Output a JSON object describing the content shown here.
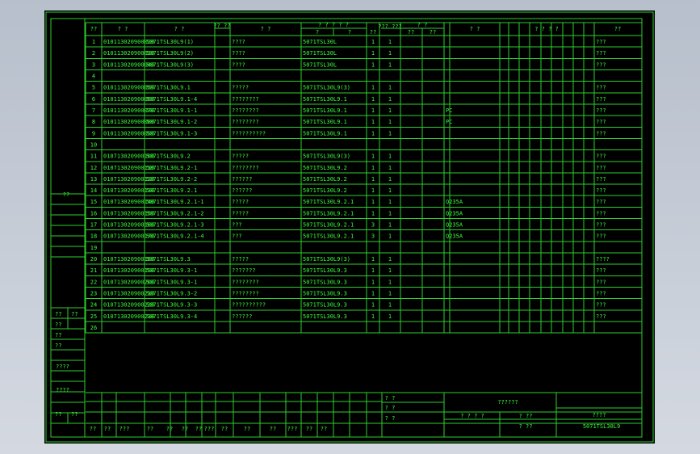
{
  "header": {
    "col_idx": "??",
    "col_code": "? ?",
    "col_drawing_no": "? ?",
    "col_mark": "?? ??",
    "col_name": "? ?",
    "col_ref_group": "? ? ? ? ?",
    "col_ref_sub1": "?",
    "col_ref_sub2": "?",
    "col_ref_sub3": "??",
    "col_qty": "??? ???",
    "col_weight": "? ?",
    "col_weight_sub1": "??",
    "col_weight_sub2": "??",
    "col_material": "? ?",
    "col_remark": "? ? ? ?",
    "col_last": "??"
  },
  "rows": [
    {
      "n": "1",
      "code": "010113020900020",
      "dwg": "5071TSL30L9(1)",
      "name": "????",
      "ref": "5071TSL30L",
      "a": "1",
      "b": "1",
      "mat": "",
      "rem": "???"
    },
    {
      "n": "2",
      "code": "010113020900030",
      "dwg": "5071TSL30L9(2)",
      "name": "????",
      "ref": "5071TSL30L",
      "a": "1",
      "b": "1",
      "mat": "",
      "rem": "???"
    },
    {
      "n": "3",
      "code": "010113020900040",
      "dwg": "5071TSL30L9(3)",
      "name": "????",
      "ref": "5071TSL30L",
      "a": "1",
      "b": "1",
      "mat": "",
      "rem": "???"
    },
    {
      "n": "4",
      "code": "",
      "dwg": "",
      "name": "",
      "ref": "",
      "a": "",
      "b": "",
      "mat": "",
      "rem": ""
    },
    {
      "n": "5",
      "code": "010113020900050",
      "dwg": "5071TSL30L9.1",
      "name": "?????",
      "ref": "5071TSL30L9(3)",
      "a": "1",
      "b": "1",
      "mat": "",
      "rem": "???"
    },
    {
      "n": "6",
      "code": "010113020900060",
      "dwg": "5071TSL30L9.1-4",
      "name": "????????",
      "ref": "5071TSL30L9.1",
      "a": "1",
      "b": "1",
      "mat": "",
      "rem": "???"
    },
    {
      "n": "7",
      "code": "010113020900070",
      "dwg": "5071TSL30L9.1-1",
      "name": "????????",
      "ref": "5071TSL30L9.1",
      "a": "1",
      "b": "1",
      "mat": "PC",
      "rem": "???"
    },
    {
      "n": "8",
      "code": "010113020900080",
      "dwg": "5071TSL30L9.1-2",
      "name": "????????",
      "ref": "5071TSL30L9.1",
      "a": "1",
      "b": "1",
      "mat": "PC",
      "rem": "???"
    },
    {
      "n": "9",
      "code": "010113020900090",
      "dwg": "5071TSL30L9.1-3",
      "name": "??????????",
      "ref": "5071TSL30L9.1",
      "a": "1",
      "b": "1",
      "mat": "",
      "rem": "???"
    },
    {
      "n": "10",
      "code": "",
      "dwg": "",
      "name": "",
      "ref": "",
      "a": "",
      "b": "",
      "mat": "",
      "rem": ""
    },
    {
      "n": "11",
      "code": "010713020900100",
      "dwg": "5071TSL30L9.2",
      "name": "?????",
      "ref": "5071TSL30L9(3)",
      "a": "1",
      "b": "1",
      "mat": "",
      "rem": "???"
    },
    {
      "n": "12",
      "code": "010713020900110",
      "dwg": "5071TSL30L9.2-1",
      "name": "????????",
      "ref": "5071TSL30L9.2",
      "a": "1",
      "b": "1",
      "mat": "",
      "rem": "???"
    },
    {
      "n": "13",
      "code": "010713020900120",
      "dwg": "5071TSL30L9.2-2",
      "name": "??????",
      "ref": "5071TSL30L9.2",
      "a": "1",
      "b": "1",
      "mat": "",
      "rem": "???"
    },
    {
      "n": "14",
      "code": "010713020900130",
      "dwg": "5071TSL30L9.2.1",
      "name": "??????",
      "ref": "5071TSL30L9.2",
      "a": "1",
      "b": "1",
      "mat": "",
      "rem": "???"
    },
    {
      "n": "15",
      "code": "010713020900140",
      "dwg": "5071TSL30L9.2.1-1",
      "name": "?????",
      "ref": "5071TSL30L9.2.1",
      "a": "1",
      "b": "1",
      "mat": "Q235A",
      "rem": "???"
    },
    {
      "n": "16",
      "code": "010713020900150",
      "dwg": "5071TSL30L9.2.1-2",
      "name": "?????",
      "ref": "5071TSL30L9.2.1",
      "a": "1",
      "b": "1",
      "mat": "Q235A",
      "rem": "???"
    },
    {
      "n": "17",
      "code": "010713020900160",
      "dwg": "5071TSL30L9.2.1-3",
      "name": "???",
      "ref": "5071TSL30L9.2.1",
      "a": "3",
      "b": "1",
      "mat": "Q235A",
      "rem": "???"
    },
    {
      "n": "18",
      "code": "010713020900170",
      "dwg": "5071TSL30L9.2.1-4",
      "name": "???",
      "ref": "5071TSL30L9.2.1",
      "a": "3",
      "b": "1",
      "mat": "Q235A",
      "rem": "???"
    },
    {
      "n": "19",
      "code": "",
      "dwg": "",
      "name": "",
      "ref": "",
      "a": "",
      "b": "",
      "mat": "",
      "rem": ""
    },
    {
      "n": "20",
      "code": "010713020900180",
      "dwg": "5071TSL30L9.3",
      "name": "?????",
      "ref": "5071TSL30L9(3)",
      "a": "1",
      "b": "1",
      "mat": "",
      "rem": "????"
    },
    {
      "n": "21",
      "code": "010713020900190",
      "dwg": "5071TSL30L9.3-1",
      "name": "???????",
      "ref": "5071TSL30L9.3",
      "a": "1",
      "b": "1",
      "mat": "",
      "rem": "???"
    },
    {
      "n": "22",
      "code": "010713020900200",
      "dwg": "5071TSL30L9.3-1",
      "name": "????????",
      "ref": "5071TSL30L9.3",
      "a": "1",
      "b": "1",
      "mat": "",
      "rem": "???"
    },
    {
      "n": "23",
      "code": "010713020900210",
      "dwg": "5071TSL30L9.3-2",
      "name": "????????",
      "ref": "5071TSL30L9.3",
      "a": "1",
      "b": "1",
      "mat": "",
      "rem": "???"
    },
    {
      "n": "24",
      "code": "010713020900220",
      "dwg": "5071TSL30L9.3-3",
      "name": "??????????",
      "ref": "5071TSL30L9.3",
      "a": "1",
      "b": "1",
      "mat": "",
      "rem": "???"
    },
    {
      "n": "25",
      "code": "010713020900230",
      "dwg": "5071TSL30L9.3-4",
      "name": "??????",
      "ref": "5071TSL30L9.3",
      "a": "1",
      "b": "1",
      "mat": "",
      "rem": "???"
    },
    {
      "n": "26",
      "code": "",
      "dwg": "",
      "name": "",
      "ref": "",
      "a": "",
      "b": "",
      "mat": "",
      "rem": ""
    }
  ],
  "left_strip": {
    "label_a": "??",
    "label_b1": "??",
    "label_b2": "??",
    "label_c": "??",
    "label_d": "??",
    "label_e": "??",
    "label_f": "????",
    "label_g": "????",
    "label_h1": "??",
    "label_h2": "??"
  },
  "title_block": {
    "top_a": "? ?",
    "top_b": "? ?",
    "top_c": "? ?",
    "title": "??????",
    "stage": "? ? ? ?",
    "weight": "? ??",
    "scale": "? ??",
    "company": "????",
    "drawing_no": "5071TSL30L9",
    "sign_labels": [
      "??",
      "??",
      "???",
      "??",
      "??",
      "??",
      "??",
      "???",
      "??",
      "??",
      "??",
      "???",
      "??",
      "??"
    ]
  }
}
